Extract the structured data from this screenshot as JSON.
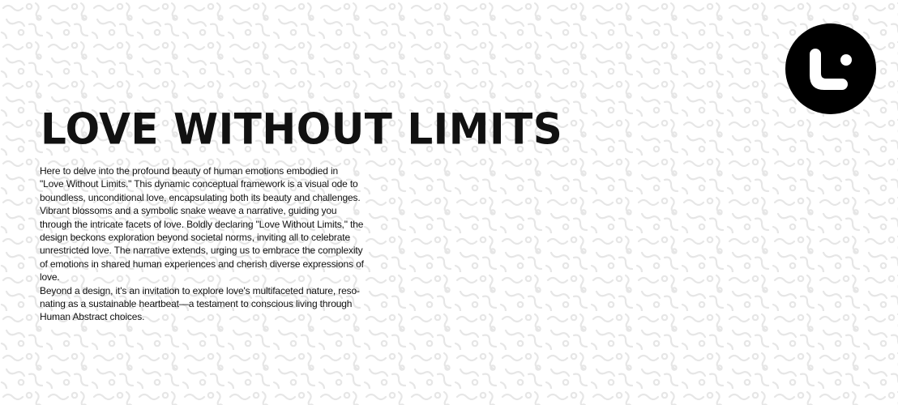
{
  "page": {
    "title": "LOVE WITHOUT LIMITS",
    "paragraphs": [
      "Here to delve into the profound beauty of human emotions embodied in\n\"Love Without Limits.\" This dynamic conceptual framework is a visual ode to\nboundless, unconditional love, encapsulating both its beauty and challenges.\nVibrant blossoms and a symbolic snake weave a narrative, guiding you\nthrough the intricate facets of love. Boldly declaring \"Love Without Limits,\" the\ndesign beckons exploration beyond societal norms, inviting all to celebrate\nunrestricted love. The narrative extends, urging us to embrace the complexity\nof emotions in shared human experiences and cherish diverse expressions of\nlove.",
      "Beyond a design, it's an invitation to explore love's multifaceted nature, reso-\nnating as a sustainable heartbeat—a testament to conscious living through\nHuman Abstract choices."
    ]
  },
  "logo": {
    "icon": "brand-logo-icon",
    "background": "#000000",
    "foreground": "#ffffff"
  },
  "colors": {
    "background": "#ffffff",
    "pattern": "#e6e6e6",
    "text": "#111111"
  }
}
